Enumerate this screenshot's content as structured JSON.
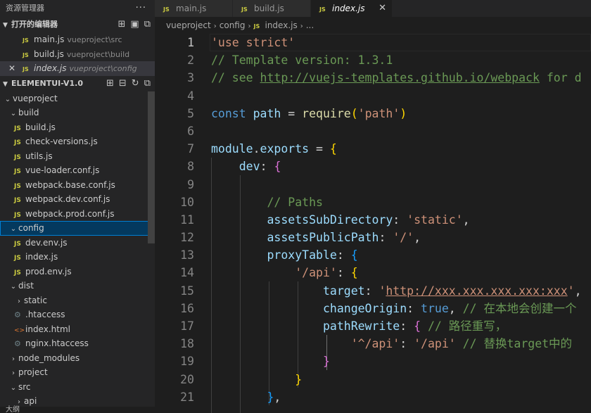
{
  "explorer": {
    "title": "资源管理器",
    "more": "···",
    "open_editors": {
      "title": "打开的编辑器",
      "items": [
        {
          "badge": "JS",
          "name": "main.js",
          "path": "vueproject\\src"
        },
        {
          "badge": "JS",
          "name": "build.js",
          "path": "vueproject\\build"
        },
        {
          "badge": "JS",
          "name": "index.js",
          "path": "vueproject\\config",
          "close": "✕"
        }
      ]
    },
    "workspace": {
      "title": "ELEMENTUI-V1.0",
      "tree": [
        {
          "label": "vueproject",
          "chev": "⌄"
        },
        {
          "label": "build",
          "chev": "⌄"
        },
        {
          "label": "build.js",
          "icon": "JS"
        },
        {
          "label": "check-versions.js",
          "icon": "JS"
        },
        {
          "label": "utils.js",
          "icon": "JS"
        },
        {
          "label": "vue-loader.conf.js",
          "icon": "JS"
        },
        {
          "label": "webpack.base.conf.js",
          "icon": "JS"
        },
        {
          "label": "webpack.dev.conf.js",
          "icon": "JS"
        },
        {
          "label": "webpack.prod.conf.js",
          "icon": "JS"
        },
        {
          "label": "config",
          "chev": "⌄"
        },
        {
          "label": "dev.env.js",
          "icon": "JS"
        },
        {
          "label": "index.js",
          "icon": "JS"
        },
        {
          "label": "prod.env.js",
          "icon": "JS"
        },
        {
          "label": "dist",
          "chev": "⌄"
        },
        {
          "label": "static",
          "chev": "›"
        },
        {
          "label": ".htaccess",
          "icon": "⚙"
        },
        {
          "label": "index.html",
          "icon": "<>"
        },
        {
          "label": "nginx.htaccess",
          "icon": "⚙"
        },
        {
          "label": "node_modules",
          "chev": "›"
        },
        {
          "label": "project",
          "chev": "›"
        },
        {
          "label": "src",
          "chev": "⌄"
        },
        {
          "label": "api",
          "chev": "›"
        }
      ]
    },
    "outline": "大纲"
  },
  "tabs": [
    {
      "badge": "JS",
      "label": "main.js"
    },
    {
      "badge": "JS",
      "label": "build.js"
    },
    {
      "badge": "JS",
      "label": "index.js",
      "close": "✕"
    }
  ],
  "breadcrumb": {
    "p1": "vueproject",
    "p2": "config",
    "badge": "JS",
    "p3": "index.js",
    "p4": "..."
  },
  "code": {
    "l1": "'use strict'",
    "l2": "// Template version: 1.3.1",
    "l3a": "// see ",
    "l3b": "http://vuejs-templates.github.io/webpack",
    "l3c": " for d",
    "l5a": "const",
    "l5b": "path",
    "l5c": "require",
    "l5d": "'path'",
    "l7a": "module",
    "l7b": "exports",
    "l8": "dev",
    "l10": "// Paths",
    "l11a": "assetsSubDirectory",
    "l11b": "'static'",
    "l12a": "assetsPublicPath",
    "l12b": "'/'",
    "l13": "proxyTable",
    "l14": "'/api'",
    "l15a": "target",
    "l15b": "'",
    "l15c": "http://xxx.xxx.xxx.xxx:xxx",
    "l15d": "'",
    "l16a": "changeOrigin",
    "l16b": "true",
    "l16c": "// 在本地会创建一个",
    "l17a": "pathRewrite",
    "l17b": "// 路径重写，",
    "l18a": "'^/api'",
    "l18b": "'/api'",
    "l18c": "// 替换target中的"
  },
  "line_numbers": [
    "1",
    "2",
    "3",
    "4",
    "5",
    "6",
    "7",
    "8",
    "9",
    "10",
    "11",
    "12",
    "13",
    "14",
    "15",
    "16",
    "17",
    "18",
    "19",
    "20",
    "21"
  ]
}
